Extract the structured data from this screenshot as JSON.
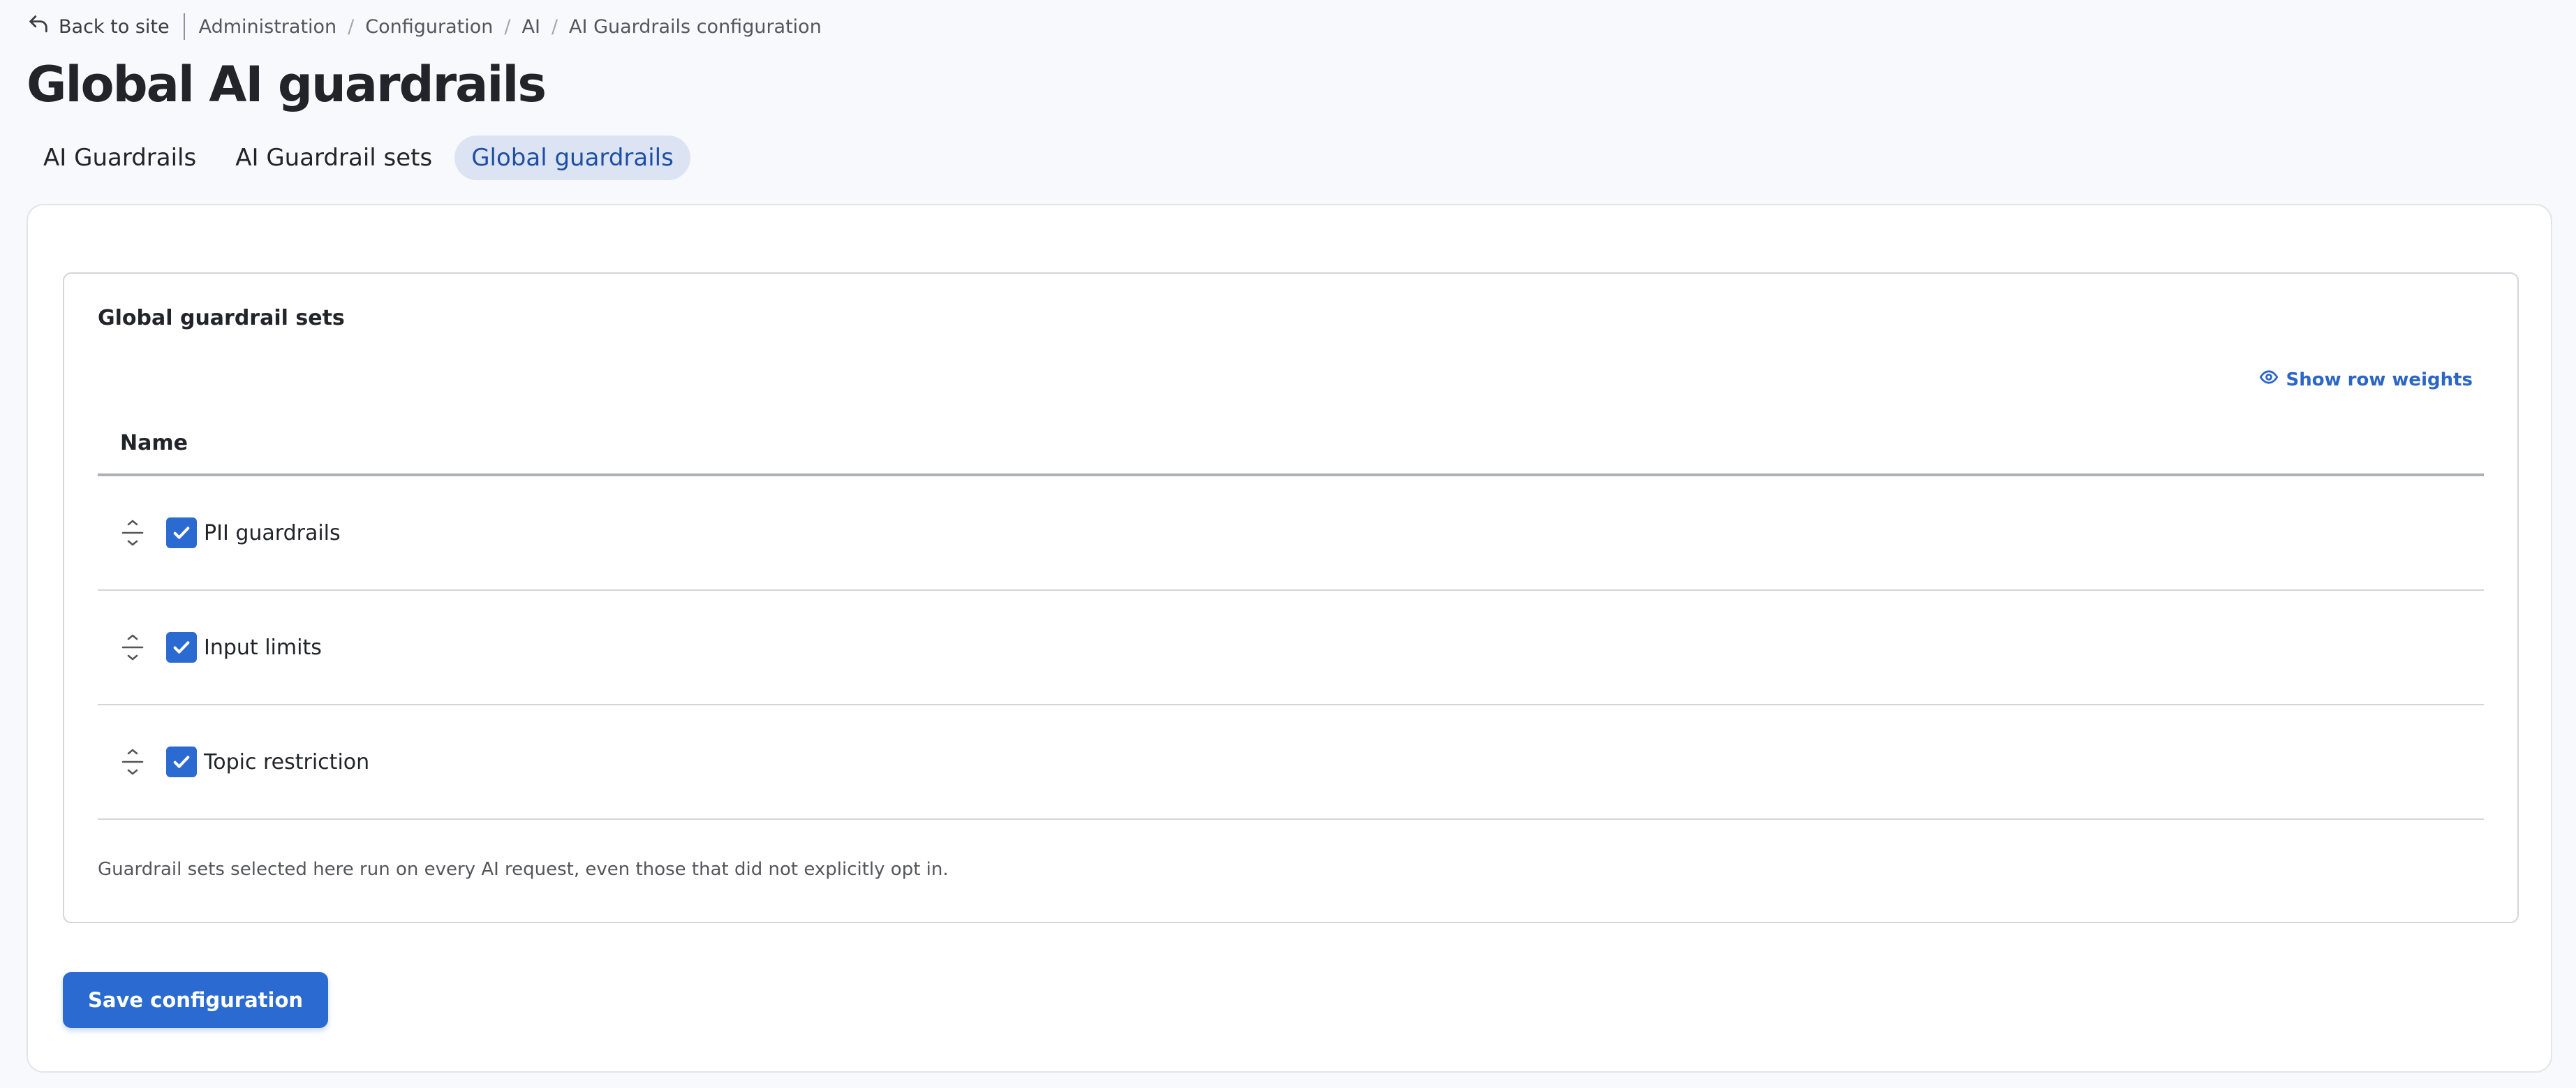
{
  "breadcrumb": {
    "back_label": "Back to site",
    "items": [
      "Administration",
      "Configuration",
      "AI",
      "AI Guardrails configuration"
    ],
    "separator": "/"
  },
  "page_title": "Global AI guardrails",
  "tabs": [
    {
      "label": "AI Guardrails",
      "active": false
    },
    {
      "label": "AI Guardrail sets",
      "active": false
    },
    {
      "label": "Global guardrails",
      "active": true
    }
  ],
  "fieldset": {
    "legend": "Global guardrail sets",
    "show_weights_label": "Show row weights",
    "table": {
      "header_name": "Name",
      "rows": [
        {
          "label": "PII guardrails",
          "checked": true
        },
        {
          "label": "Input limits",
          "checked": true
        },
        {
          "label": "Topic restriction",
          "checked": true
        }
      ]
    },
    "description": "Guardrail sets selected here run on every AI request, even those that did not explicitly opt in."
  },
  "save_button_label": "Save configuration",
  "colors": {
    "accent": "#2b6ad0",
    "active_tab_bg": "#dce4f4",
    "active_tab_text": "#1e4fa3",
    "background": "#f8f9fd"
  },
  "icons": {
    "back": "back-arrow-icon",
    "show_weights": "eye-icon",
    "drag": "drag-handle-icon",
    "check": "checkmark-icon"
  }
}
